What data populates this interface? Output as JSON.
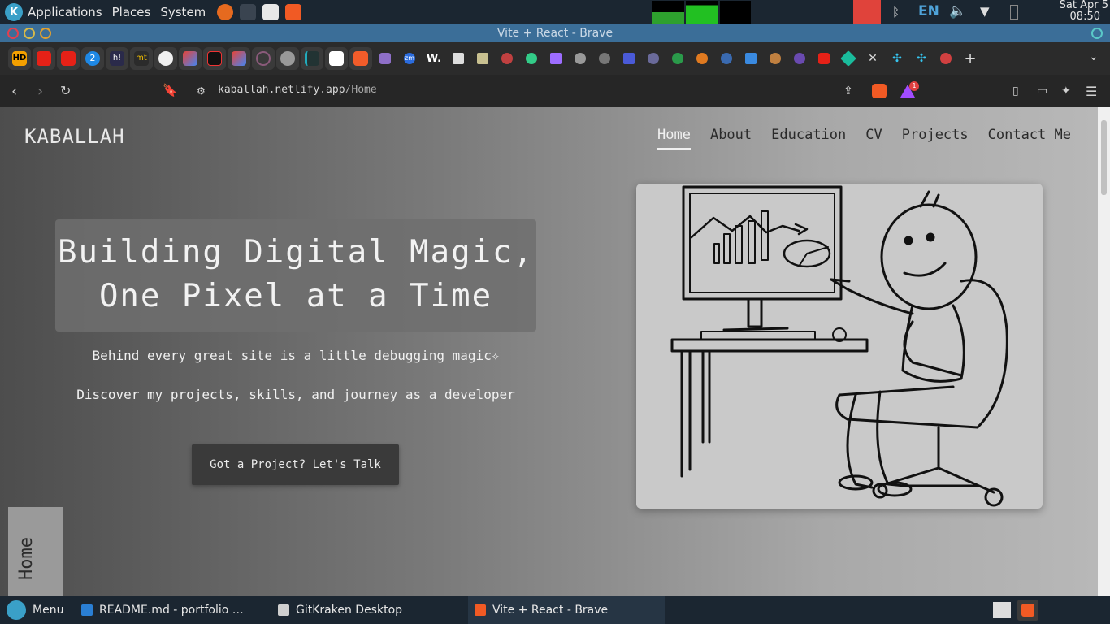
{
  "system": {
    "menus": [
      "Applications",
      "Places",
      "System"
    ],
    "language": "EN",
    "clock_date": "Sat Apr  5",
    "clock_time": "08:50"
  },
  "window": {
    "title": "Vite + React - Brave"
  },
  "browser": {
    "url_domain": "kaballah.netlify.app",
    "url_path": "/Home",
    "bookmark_labels": [
      "HD",
      "2",
      "h!",
      "mt",
      "zm",
      "W."
    ],
    "notification_count": "1"
  },
  "page": {
    "brand": "KABALLAH",
    "nav": [
      "Home",
      "About",
      "Education",
      "CV",
      "Projects",
      "Contact Me"
    ],
    "hero_line1": "Building Digital Magic,",
    "hero_line2": "One Pixel at a Time",
    "subtitle1": "Behind every great site is a little debugging magic✧",
    "subtitle2": "Discover my projects, skills, and journey as a developer",
    "cta": "Got a Project? Let's Talk",
    "side_tab": "Home"
  },
  "taskbar": {
    "menu": "Menu",
    "tasks": [
      "README.md - portfolio …",
      "GitKraken Desktop",
      "Vite + React - Brave"
    ]
  }
}
